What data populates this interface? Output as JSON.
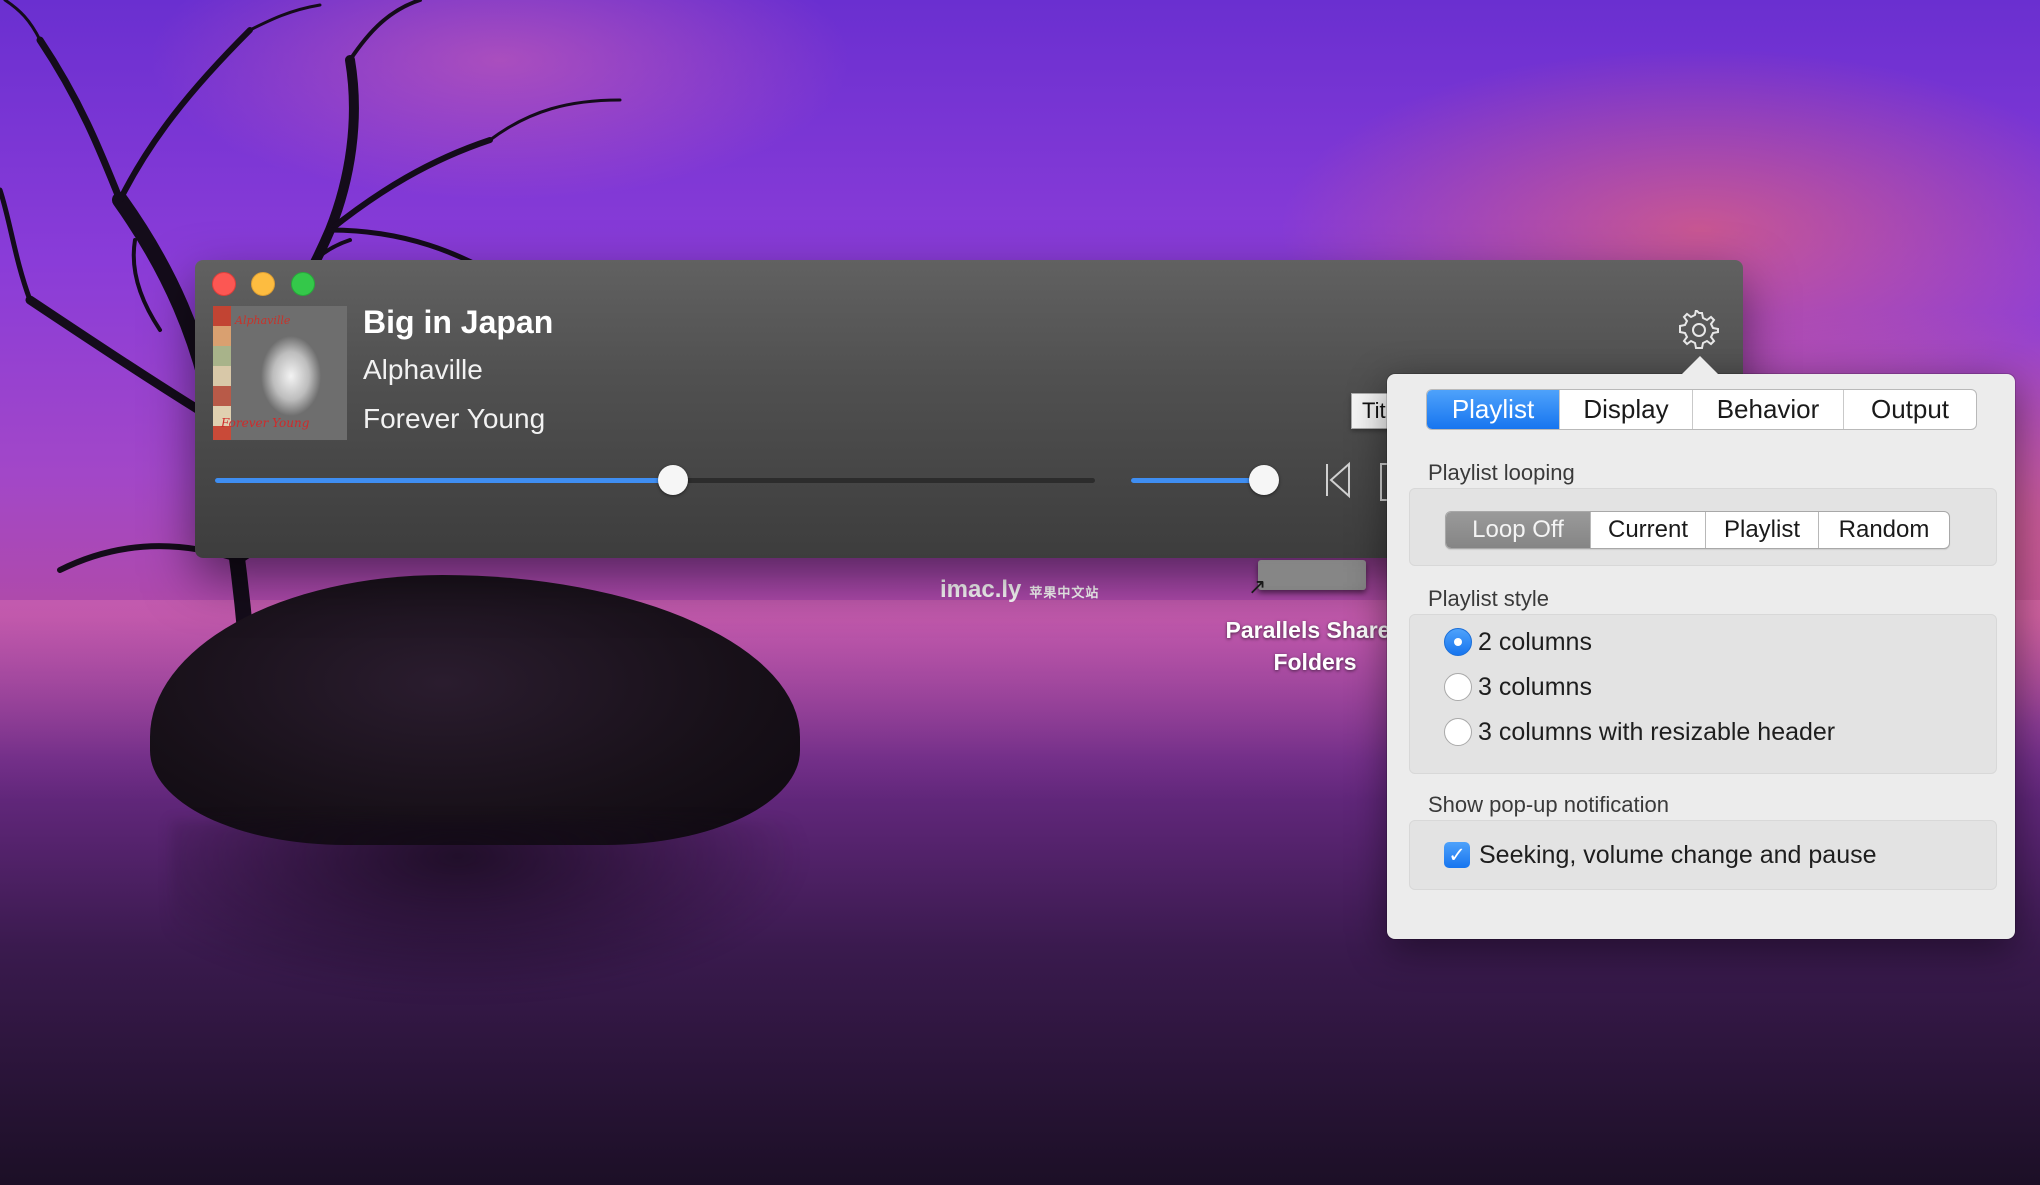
{
  "player": {
    "track_title": "Big in Japan",
    "track_artist": "Alphaville",
    "track_album": "Forever Young",
    "album_art_text_top": "Alphaville",
    "album_art_text_bottom": "Forever Young",
    "seek_progress": 0.52,
    "volume_level": 0.91
  },
  "tooltip": {
    "text": "Title"
  },
  "settings": {
    "tabs": [
      {
        "label": "Playlist",
        "active": true
      },
      {
        "label": "Display",
        "active": false
      },
      {
        "label": "Behavior",
        "active": false
      },
      {
        "label": "Output",
        "active": false
      }
    ],
    "looping": {
      "title": "Playlist looping",
      "options": [
        "Loop Off",
        "Current",
        "Playlist",
        "Random"
      ],
      "selected": "Loop Off"
    },
    "style": {
      "title": "Playlist style",
      "options": [
        "2 columns",
        "3 columns",
        "3 columns with resizable header"
      ],
      "selected": "2 columns"
    },
    "notification": {
      "title": "Show pop-up notification",
      "option": "Seeking, volume change and pause",
      "checked": true
    }
  },
  "desktop": {
    "watermark": "imac.ly",
    "watermark_sub": "苹果中文站",
    "drive_label_line1": "Parallels Shared",
    "drive_label_line2": "Folders"
  },
  "colors": {
    "accent": "#1775ef",
    "slider_fill": "#3f8ef2",
    "close": "#fc5753",
    "minimize": "#fdbc40",
    "maximize": "#34c84a"
  },
  "icons": [
    "close-icon",
    "minimize-icon",
    "maximize-icon",
    "gear-icon",
    "previous-track-icon",
    "drive-icon",
    "alias-arrow-icon",
    "checkmark-icon"
  ]
}
